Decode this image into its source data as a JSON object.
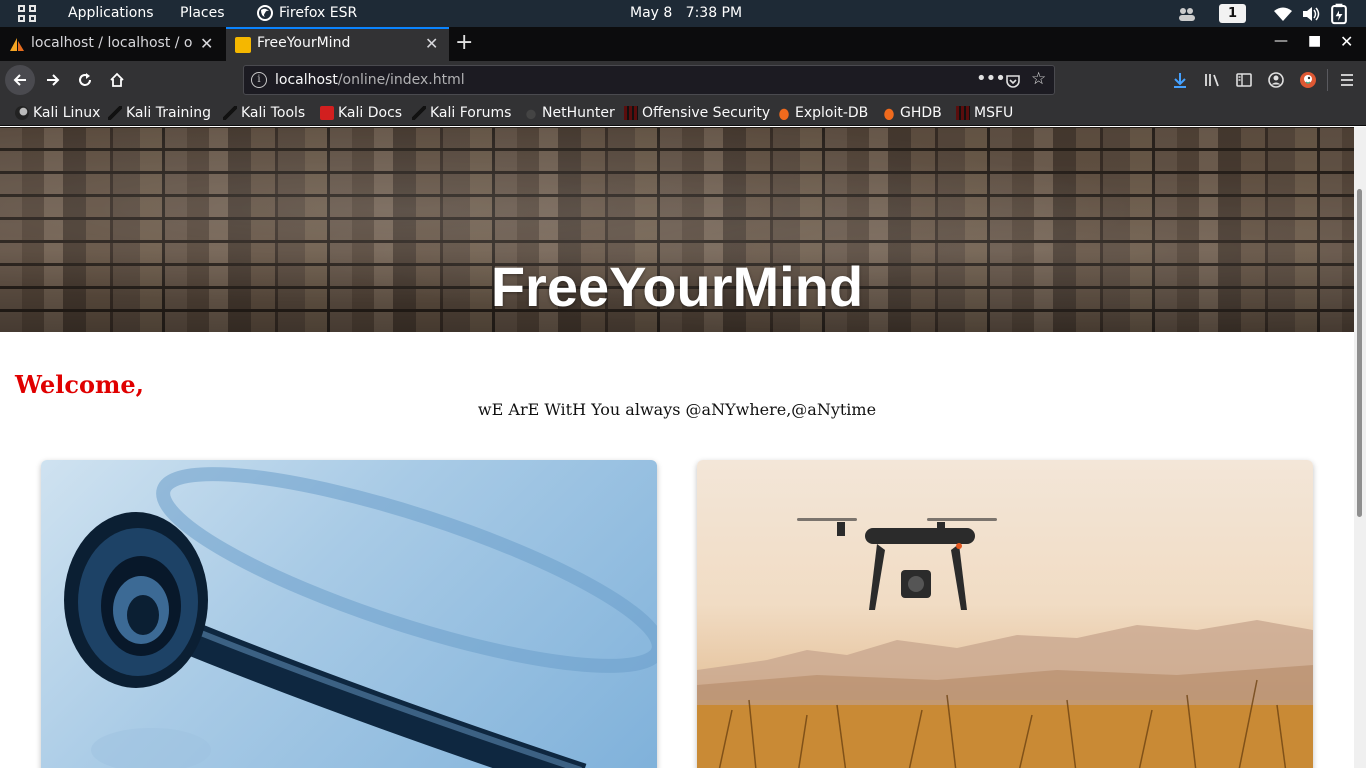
{
  "system_panel": {
    "applications": "Applications",
    "places": "Places",
    "active_app": "Firefox ESR",
    "date": "May 8",
    "time": "7:38 PM",
    "workspace": "1"
  },
  "tabs": [
    {
      "title": "localhost / localhost / onli",
      "active": false
    },
    {
      "title": "FreeYourMind",
      "active": true
    }
  ],
  "navbar": {
    "url_host": "localhost",
    "url_path": "/online/index.html"
  },
  "bookmarks": [
    {
      "label": "Kali Linux",
      "icon": "kali-dragon-icon"
    },
    {
      "label": "Kali Training",
      "icon": "kali-dragon-icon"
    },
    {
      "label": "Kali Tools",
      "icon": "kali-dragon-icon"
    },
    {
      "label": "Kali Docs",
      "icon": "kali-docs-icon"
    },
    {
      "label": "Kali Forums",
      "icon": "kali-dragon-icon"
    },
    {
      "label": "NetHunter",
      "icon": "nethunter-icon"
    },
    {
      "label": "Offensive Security",
      "icon": "offsec-icon"
    },
    {
      "label": "Exploit-DB",
      "icon": "exploitdb-icon"
    },
    {
      "label": "GHDB",
      "icon": "exploitdb-icon"
    },
    {
      "label": "MSFU",
      "icon": "offsec-icon"
    }
  ],
  "page": {
    "hero_title": "FreeYourMind",
    "welcome": "Welcome,",
    "tagline": "wE ArE WitH You always @aNYwhere,@aNytime"
  },
  "colors": {
    "welcome": "#e00000",
    "tab_accent": "#0a84ff",
    "panel_bg": "#1e2a36"
  }
}
